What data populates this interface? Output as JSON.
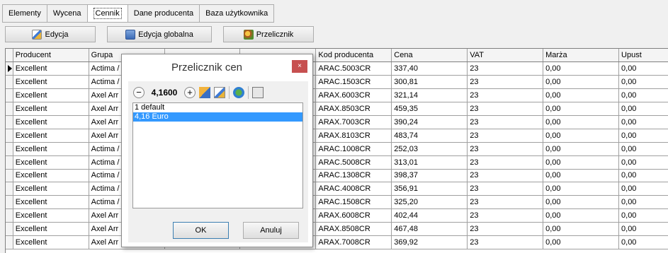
{
  "tabs": [
    "Elementy",
    "Wycena",
    "Cennik",
    "Dane producenta",
    "Baza użytkownika"
  ],
  "active_tab": 2,
  "toolbar": {
    "edit_label": "Edycja",
    "global_edit_label": "Edycja globalna",
    "converter_label": "Przelicznik"
  },
  "grid": {
    "columns": [
      "Producent",
      "Grupa",
      "",
      "",
      "Kod producenta",
      "Cena",
      "VAT",
      "Marża",
      "Upust"
    ],
    "rows": [
      {
        "producent": "Excellent",
        "grupa": "Actima /",
        "kod": "ARAC.5003CR",
        "cena": "337,40",
        "vat": "23",
        "marza": "0,00",
        "upust": "0,00"
      },
      {
        "producent": "Excellent",
        "grupa": "Actima /",
        "kod": "ARAC.1503CR",
        "cena": "300,81",
        "vat": "23",
        "marza": "0,00",
        "upust": "0,00"
      },
      {
        "producent": "Excellent",
        "grupa": "Axel Arr",
        "kod": "ARAX.6003CR",
        "cena": "321,14",
        "vat": "23",
        "marza": "0,00",
        "upust": "0,00"
      },
      {
        "producent": "Excellent",
        "grupa": "Axel Arr",
        "kod": "ARAX.8503CR",
        "cena": "459,35",
        "vat": "23",
        "marza": "0,00",
        "upust": "0,00"
      },
      {
        "producent": "Excellent",
        "grupa": "Axel Arr",
        "kod": "ARAX.7003CR",
        "cena": "390,24",
        "vat": "23",
        "marza": "0,00",
        "upust": "0,00"
      },
      {
        "producent": "Excellent",
        "grupa": "Axel Arr",
        "kod": "ARAX.8103CR",
        "cena": "483,74",
        "vat": "23",
        "marza": "0,00",
        "upust": "0,00"
      },
      {
        "producent": "Excellent",
        "grupa": "Actima /",
        "kod": "ARAC.1008CR",
        "cena": "252,03",
        "vat": "23",
        "marza": "0,00",
        "upust": "0,00"
      },
      {
        "producent": "Excellent",
        "grupa": "Actima /",
        "kod": "ARAC.5008CR",
        "cena": "313,01",
        "vat": "23",
        "marza": "0,00",
        "upust": "0,00"
      },
      {
        "producent": "Excellent",
        "grupa": "Actima /",
        "kod": "ARAC.1308CR",
        "cena": "398,37",
        "vat": "23",
        "marza": "0,00",
        "upust": "0,00"
      },
      {
        "producent": "Excellent",
        "grupa": "Actima /",
        "kod": "ARAC.4008CR",
        "cena": "356,91",
        "vat": "23",
        "marza": "0,00",
        "upust": "0,00"
      },
      {
        "producent": "Excellent",
        "grupa": "Actima /",
        "kod": "ARAC.1508CR",
        "cena": "325,20",
        "vat": "23",
        "marza": "0,00",
        "upust": "0,00"
      },
      {
        "producent": "Excellent",
        "grupa": "Axel Arr",
        "kod": "ARAX.6008CR",
        "cena": "402,44",
        "vat": "23",
        "marza": "0,00",
        "upust": "0,00"
      },
      {
        "producent": "Excellent",
        "grupa": "Axel Arr",
        "kod": "ARAX.8508CR",
        "cena": "467,48",
        "vat": "23",
        "marza": "0,00",
        "upust": "0,00"
      },
      {
        "producent": "Excellent",
        "grupa": "Axel Arr",
        "kod": "ARAX.7008CR",
        "cena": "369,92",
        "vat": "23",
        "marza": "0,00",
        "upust": "0,00"
      }
    ]
  },
  "dialog": {
    "title": "Przelicznik cen",
    "close_label": "×",
    "value": "4,1600",
    "minus": "−",
    "plus": "+",
    "items": [
      "1 default",
      "4,16 Euro"
    ],
    "selected_index": 1,
    "ok_label": "OK",
    "cancel_label": "Anuluj"
  }
}
